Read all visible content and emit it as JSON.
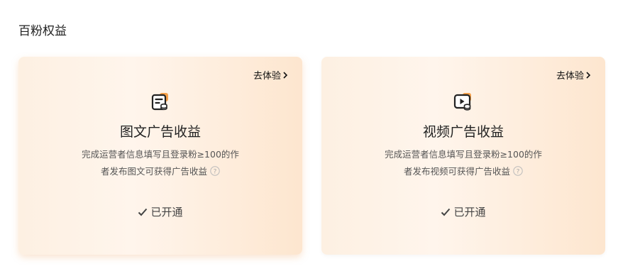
{
  "section": {
    "title": "百粉权益"
  },
  "cards": [
    {
      "icon": "article-ad-icon",
      "try_label": "去体验",
      "title": "图文广告收益",
      "desc_line1": "完成运营者信息填写且登录粉≥100的作",
      "desc_line2": "者发布图文可获得广告收益",
      "status": "已开通"
    },
    {
      "icon": "video-ad-icon",
      "try_label": "去体验",
      "title": "视频广告收益",
      "desc_line1": "完成运营者信息填写且登录粉≥100的作",
      "desc_line2": "者发布视频可获得广告收益",
      "status": "已开通"
    }
  ],
  "colors": {
    "accent": "#f5a04a",
    "icon_dark": "#222222"
  }
}
